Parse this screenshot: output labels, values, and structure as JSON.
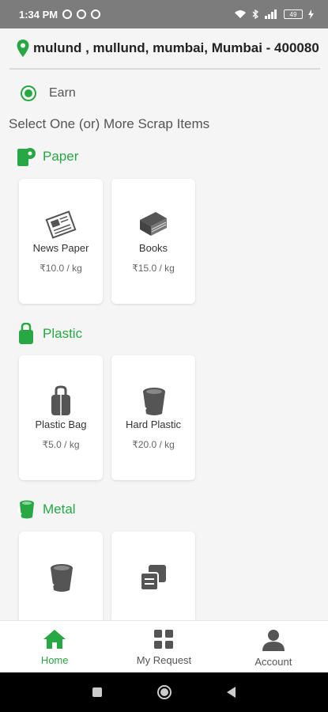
{
  "status_bar": {
    "time": "1:34 PM",
    "battery": "49"
  },
  "address": {
    "text": "mulund , mullund, mumbai, Mumbai  - 400080"
  },
  "mode": {
    "label": "Earn",
    "selected": true
  },
  "instructions": "Select One (or) More Scrap Items",
  "categories": [
    {
      "label": "Paper",
      "icon": "paper-roll-icon",
      "items": [
        {
          "name": "News Paper",
          "price": "₹10.0 / kg",
          "icon": "newspaper-icon"
        },
        {
          "name": "Books",
          "price": "₹15.0 / kg",
          "icon": "book-icon"
        }
      ]
    },
    {
      "label": "Plastic",
      "icon": "plastic-bag-icon",
      "items": [
        {
          "name": "Plastic Bag",
          "price": "₹5.0 / kg",
          "icon": "plastic-bag-icon"
        },
        {
          "name": "Hard Plastic",
          "price": "₹20.0 / kg",
          "icon": "bucket-icon"
        }
      ]
    },
    {
      "label": "Metal",
      "icon": "bucket-icon",
      "items": [
        {
          "name": "",
          "price": "",
          "icon": "bucket-icon"
        },
        {
          "name": "",
          "price": "",
          "icon": "stacked-squares-icon"
        }
      ]
    }
  ],
  "bottom_nav": [
    {
      "label": "Home",
      "icon": "home-icon",
      "active": true
    },
    {
      "label": "My Request",
      "icon": "grid-icon",
      "active": false
    },
    {
      "label": "Account",
      "icon": "person-icon",
      "active": false
    }
  ],
  "colors": {
    "accent": "#27a844",
    "status_bar": "#7c7c7c",
    "icon_gray": "#555555"
  }
}
